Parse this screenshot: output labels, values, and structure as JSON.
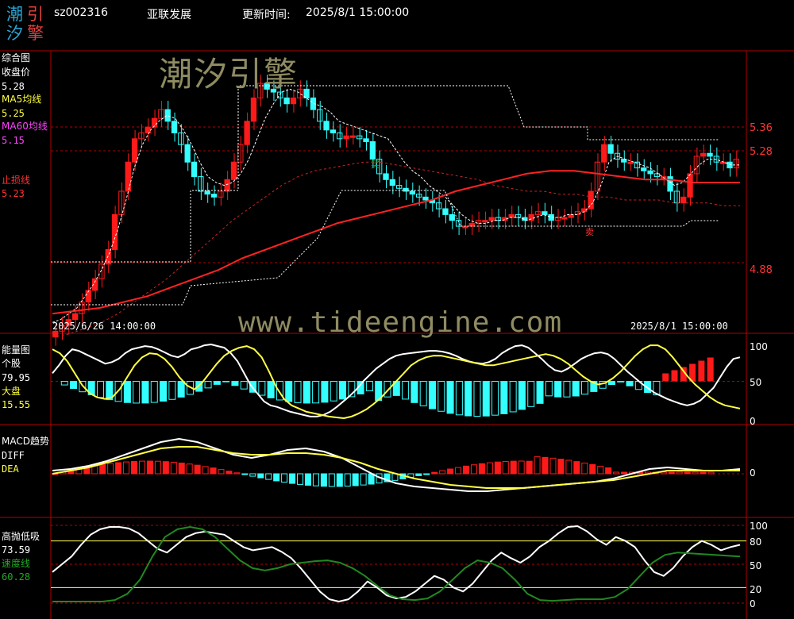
{
  "header": {
    "logo_chars": [
      "潮",
      "汐",
      "引",
      "擎"
    ],
    "code": "sz002316",
    "name": "亚联发展",
    "update_label": "更新时间:",
    "update_time": "2025/8/1 15:00:00"
  },
  "watermarks": {
    "brand": "潮汐引擎",
    "url": "www.tideengine.com"
  },
  "colors": {
    "up": "#ff1a1a",
    "down": "#33ffff",
    "ma5": "#ffffff",
    "ma60": "#cc2222",
    "white_line": "#ffffff",
    "yellow_line": "#ffff44",
    "green_line": "#228822",
    "grid_red": "#b00000"
  },
  "main_panel": {
    "title": "综合图",
    "close_label": "收盘价",
    "close_value": "5.28",
    "ma5_label": "MA5均线",
    "ma5_value": "5.25",
    "ma60_label": "MA60均线",
    "ma60_value": "5.15",
    "stop_label": "止损线",
    "stop_value": "5.23",
    "axis_labels": [
      "5.36",
      "5.28",
      "4.88"
    ],
    "start_date": "2025/6/26 14:00:00",
    "end_date": "2025/8/1 15:00:00",
    "marker_buy": "买",
    "marker_sell": "卖"
  },
  "energy_panel": {
    "title": "能量图",
    "stock_label": "个股",
    "stock_value": "79.95",
    "market_label": "大盘",
    "market_value": "15.55",
    "axis_labels": [
      "100",
      "50",
      "0"
    ]
  },
  "macd_panel": {
    "title": "MACD趋势",
    "diff_label": "DIFF",
    "dea_label": "DEA",
    "axis_labels": [
      "0"
    ]
  },
  "osc_panel": {
    "title": "高抛低吸",
    "value": "73.59",
    "speed_label": "速度线",
    "speed_value": "60.28",
    "axis_labels": [
      "100",
      "80",
      "50",
      "20",
      "0"
    ]
  },
  "chart_data": [
    {
      "type": "candlestick",
      "title": "综合图",
      "ylim": [
        4.74,
        5.6
      ],
      "closes": [
        4.72,
        4.74,
        4.76,
        4.78,
        4.82,
        4.86,
        4.9,
        4.95,
        5.0,
        5.12,
        5.2,
        5.3,
        5.38,
        5.4,
        5.42,
        5.45,
        5.48,
        5.44,
        5.4,
        5.36,
        5.3,
        5.25,
        5.2,
        5.19,
        5.18,
        5.2,
        5.24,
        5.3,
        5.36,
        5.44,
        5.52,
        5.57,
        5.55,
        5.54,
        5.52,
        5.5,
        5.52,
        5.55,
        5.52,
        5.48,
        5.44,
        5.41,
        5.4,
        5.38,
        5.39,
        5.39,
        5.38,
        5.37,
        5.31,
        5.26,
        5.24,
        5.22,
        5.21,
        5.2,
        5.19,
        5.18,
        5.17,
        5.16,
        5.14,
        5.12,
        5.1,
        5.08,
        5.08,
        5.09,
        5.1,
        5.1,
        5.11,
        5.1,
        5.11,
        5.12,
        5.11,
        5.1,
        5.12,
        5.13,
        5.12,
        5.1,
        5.11,
        5.11,
        5.12,
        5.13,
        5.14,
        5.2,
        5.3,
        5.36,
        5.33,
        5.31,
        5.3,
        5.3,
        5.28,
        5.27,
        5.26,
        5.25,
        5.25,
        5.2,
        5.16,
        5.18,
        5.26,
        5.32,
        5.33,
        5.32,
        5.3,
        5.3,
        5.28,
        5.31
      ],
      "ma5": [
        4.75,
        4.76,
        4.78,
        4.8,
        4.84,
        4.88,
        4.93,
        4.99,
        5.07,
        5.17,
        5.28,
        5.36,
        5.41,
        5.44,
        5.46,
        5.45,
        5.41,
        5.36,
        5.3,
        5.25,
        5.23,
        5.22,
        5.23,
        5.26,
        5.31,
        5.38,
        5.45,
        5.5,
        5.54,
        5.55,
        5.54,
        5.52,
        5.5,
        5.49,
        5.47,
        5.44,
        5.43,
        5.42,
        5.41,
        5.4,
        5.39,
        5.38,
        5.34,
        5.3,
        5.27,
        5.25,
        5.22,
        5.2,
        5.18,
        5.15,
        5.12,
        5.1,
        5.09,
        5.09,
        5.1,
        5.1,
        5.11,
        5.11,
        5.1,
        5.11,
        5.12,
        5.11,
        5.11,
        5.12,
        5.12,
        5.13,
        5.16,
        5.22,
        5.3,
        5.32,
        5.31,
        5.3,
        5.29,
        5.28,
        5.26,
        5.24,
        5.22,
        5.23,
        5.26,
        5.29,
        5.31,
        5.31,
        5.3,
        5.29,
        5.29
      ],
      "ma60": [
        4.7,
        4.71,
        4.73,
        4.75,
        4.78,
        4.82,
        4.86,
        4.9,
        4.95,
        5.0,
        5.05,
        5.1,
        5.14,
        5.18,
        5.22,
        5.25,
        5.27,
        5.28,
        5.29,
        5.3,
        5.3,
        5.29,
        5.28,
        5.27,
        5.26,
        5.25,
        5.24,
        5.22,
        5.21,
        5.2,
        5.2,
        5.19,
        5.19,
        5.18,
        5.18,
        5.17,
        5.17,
        5.17,
        5.16,
        5.16,
        5.16,
        5.15,
        5.15
      ],
      "stop_line": [
        4.78,
        4.79,
        4.8,
        4.82,
        4.84,
        4.87,
        4.9,
        4.93,
        4.97,
        5.0,
        5.03,
        5.06,
        5.09,
        5.11,
        5.13,
        5.15,
        5.17,
        5.2,
        5.22,
        5.24,
        5.26,
        5.27,
        5.27,
        5.26,
        5.25,
        5.24,
        5.24,
        5.23,
        5.23,
        5.23
      ],
      "upper_band": 5.55,
      "lower_band": 4.7,
      "buy_marker_near": 5.06,
      "sell_marker_near": 5.06
    },
    {
      "type": "bar+line",
      "title": "能量图",
      "ylim": [
        0,
        100
      ],
      "stock_line": [
        60,
        70,
        82,
        90,
        88,
        84,
        80,
        76,
        72,
        74,
        78,
        85,
        90,
        92,
        94,
        93,
        90,
        86,
        82,
        80,
        84,
        90,
        92,
        95,
        96,
        94,
        92,
        85,
        75,
        60,
        45,
        35,
        25,
        20,
        18,
        15,
        12,
        10,
        8,
        6,
        6,
        8,
        12,
        18,
        25,
        32,
        40,
        50,
        58,
        66,
        72,
        78,
        82,
        84,
        85,
        86,
        87,
        88,
        88,
        87,
        85,
        82,
        78,
        75,
        73,
        72,
        74,
        78,
        85,
        90,
        94,
        95,
        92,
        85,
        78,
        70,
        64,
        62,
        66,
        72,
        78,
        82,
        85,
        86,
        84,
        78,
        70,
        62,
        55,
        48,
        42,
        36,
        32,
        28,
        25,
        22,
        20,
        22,
        26,
        34,
        42,
        55,
        68,
        78,
        80
      ],
      "market_line": [
        90,
        85,
        75,
        60,
        45,
        35,
        30,
        28,
        30,
        40,
        55,
        70,
        80,
        85,
        84,
        78,
        68,
        55,
        45,
        40,
        48,
        60,
        72,
        82,
        88,
        92,
        94,
        90,
        80,
        62,
        42,
        28,
        20,
        16,
        12,
        10,
        8,
        6,
        5,
        4,
        6,
        10,
        15,
        22,
        30,
        40,
        50,
        60,
        70,
        76,
        80,
        82,
        82,
        80,
        78,
        76,
        74,
        72,
        70,
        70,
        72,
        74,
        76,
        78,
        80,
        82,
        84,
        82,
        78,
        72,
        64,
        56,
        50,
        46,
        48,
        54,
        62,
        72,
        82,
        90,
        95,
        95,
        90,
        80,
        68,
        56,
        46,
        38,
        30,
        24,
        20,
        18,
        16
      ]
    },
    {
      "type": "bar+line",
      "title": "MACD趋势",
      "series": [
        {
          "name": "DIFF",
          "values": [
            0.02,
            0.03,
            0.05,
            0.08,
            0.12,
            0.16,
            0.2,
            0.22,
            0.2,
            0.16,
            0.12,
            0.1,
            0.12,
            0.15,
            0.16,
            0.14,
            0.1,
            0.04,
            -0.02,
            -0.06,
            -0.08,
            -0.09,
            -0.1,
            -0.11,
            -0.11,
            -0.1,
            -0.09,
            -0.08,
            -0.07,
            -0.06,
            -0.05,
            -0.03,
            0.0,
            0.03,
            0.04,
            0.03,
            0.02,
            0.02,
            0.03
          ]
        },
        {
          "name": "DEA",
          "values": [
            0.0,
            0.02,
            0.04,
            0.07,
            0.1,
            0.13,
            0.16,
            0.17,
            0.17,
            0.15,
            0.13,
            0.12,
            0.12,
            0.13,
            0.13,
            0.12,
            0.1,
            0.07,
            0.03,
            0.0,
            -0.03,
            -0.05,
            -0.07,
            -0.08,
            -0.09,
            -0.09,
            -0.09,
            -0.08,
            -0.07,
            -0.06,
            -0.05,
            -0.04,
            -0.02,
            0.0,
            0.02,
            0.02,
            0.02,
            0.02,
            0.02
          ]
        }
      ]
    },
    {
      "type": "line",
      "title": "高抛低吸",
      "ylim": [
        0,
        100
      ],
      "series": [
        {
          "name": "高抛低吸",
          "values": [
            40,
            50,
            60,
            75,
            88,
            95,
            98,
            98,
            96,
            90,
            80,
            70,
            65,
            75,
            85,
            90,
            92,
            90,
            88,
            80,
            72,
            68,
            70,
            72,
            66,
            58,
            45,
            30,
            15,
            5,
            2,
            5,
            15,
            28,
            20,
            10,
            6,
            8,
            15,
            25,
            35,
            30,
            20,
            15,
            25,
            40,
            55,
            65,
            58,
            52,
            60,
            72,
            80,
            90,
            98,
            99,
            92,
            82,
            75,
            85,
            80,
            72,
            55,
            40,
            35,
            45,
            60,
            72,
            80,
            75,
            68,
            72,
            75
          ]
        },
        {
          "name": "速度线",
          "values": [
            2,
            2,
            2,
            2,
            2,
            4,
            12,
            30,
            60,
            85,
            95,
            98,
            95,
            85,
            70,
            55,
            45,
            42,
            45,
            50,
            52,
            54,
            55,
            52,
            45,
            35,
            22,
            10,
            5,
            4,
            6,
            15,
            30,
            45,
            55,
            52,
            45,
            30,
            12,
            4,
            3,
            4,
            5,
            5,
            5,
            8,
            18,
            35,
            52,
            62,
            65,
            64,
            63,
            62,
            61,
            60
          ]
        }
      ]
    }
  ]
}
